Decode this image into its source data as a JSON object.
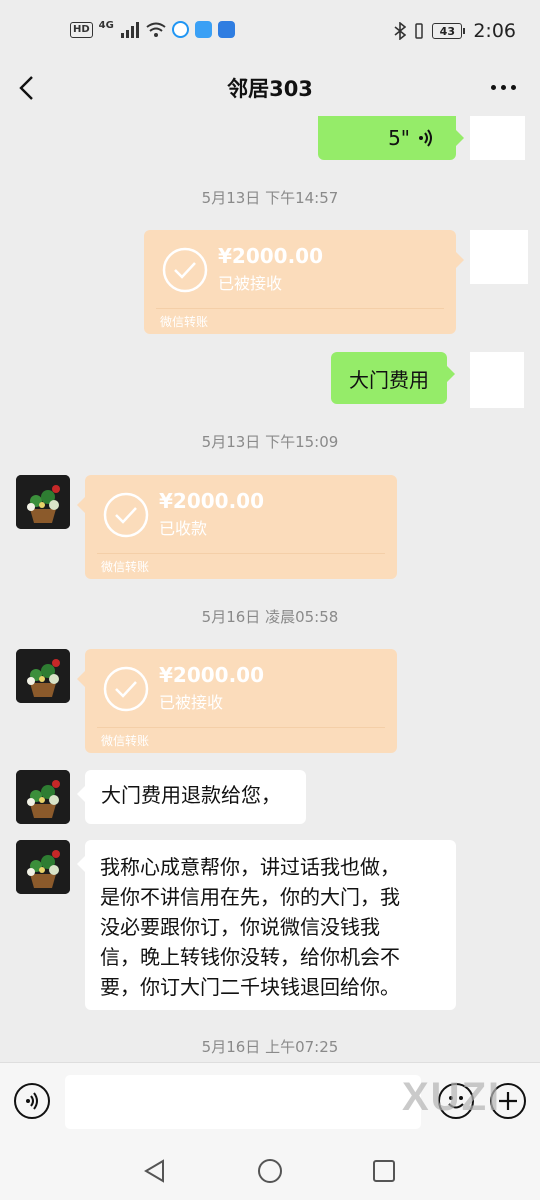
{
  "status_bar": {
    "hd": "HD",
    "network": "4G",
    "battery": "43",
    "time": "2:06"
  },
  "header": {
    "title": "邻居303"
  },
  "messages": {
    "voice_duration": "5\"",
    "time1": "5月13日 下午14:57",
    "transfer1": {
      "amount": "¥2000.00",
      "state": "已被接收",
      "label": "微信转账"
    },
    "text_gate_fee": "大门费用",
    "time2": "5月13日 下午15:09",
    "transfer2": {
      "amount": "¥2000.00",
      "state": "已收款",
      "label": "微信转账"
    },
    "time3": "5月16日 凌晨05:58",
    "transfer3": {
      "amount": "¥2000.00",
      "state": "已被接收",
      "label": "微信转账"
    },
    "text_refund": "大门费用退款给您，",
    "text_long": [
      "我称心成意帮你，讲过话我也做，",
      "是你不讲信用在先，你的大门，我",
      "没必要跟你订，你说微信没钱我",
      "信，晚上转钱你没转，给你机会不",
      "要，你订大门二千块钱退回给你。"
    ],
    "time4": "5月16日 上午07:25"
  },
  "watermark": "XUZI",
  "colors": {
    "background": "#ededed",
    "sent_bubble": "#95ec69",
    "transfer_bubble": "#fbdcbb"
  }
}
